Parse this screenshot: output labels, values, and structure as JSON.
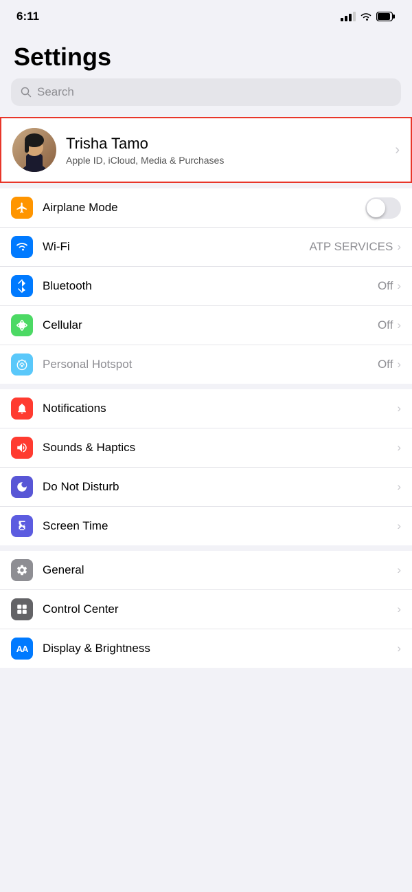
{
  "statusBar": {
    "time": "6:11"
  },
  "pageTitle": "Settings",
  "search": {
    "placeholder": "Search"
  },
  "profile": {
    "name": "Trisha Tamo",
    "subtitle": "Apple ID, iCloud, Media & Purchases"
  },
  "groups": [
    {
      "id": "connectivity",
      "rows": [
        {
          "id": "airplane",
          "label": "Airplane Mode",
          "iconColor": "ic-orange",
          "iconSymbol": "✈",
          "type": "toggle",
          "value": false
        },
        {
          "id": "wifi",
          "label": "Wi-Fi",
          "iconColor": "ic-blue",
          "iconSymbol": "wifi",
          "type": "value",
          "value": "ATP SERVICES"
        },
        {
          "id": "bluetooth",
          "label": "Bluetooth",
          "iconColor": "ic-blue-mid",
          "iconSymbol": "bt",
          "type": "value",
          "value": "Off"
        },
        {
          "id": "cellular",
          "label": "Cellular",
          "iconColor": "ic-green",
          "iconSymbol": "cell",
          "type": "value",
          "value": "Off"
        },
        {
          "id": "hotspot",
          "label": "Personal Hotspot",
          "iconColor": "ic-green-light",
          "iconSymbol": "hotspot",
          "type": "value",
          "value": "Off",
          "dimmed": true
        }
      ]
    },
    {
      "id": "notifications",
      "rows": [
        {
          "id": "notifications",
          "label": "Notifications",
          "iconColor": "ic-red",
          "iconSymbol": "notif",
          "type": "arrow"
        },
        {
          "id": "sounds",
          "label": "Sounds & Haptics",
          "iconColor": "ic-red-sound",
          "iconSymbol": "sound",
          "type": "arrow"
        },
        {
          "id": "donotdisturb",
          "label": "Do Not Disturb",
          "iconColor": "ic-purple",
          "iconSymbol": "moon",
          "type": "arrow"
        },
        {
          "id": "screentime",
          "label": "Screen Time",
          "iconColor": "ic-indigo",
          "iconSymbol": "hourglass",
          "type": "arrow"
        }
      ]
    },
    {
      "id": "system",
      "rows": [
        {
          "id": "general",
          "label": "General",
          "iconColor": "ic-gray",
          "iconSymbol": "gear",
          "type": "arrow"
        },
        {
          "id": "controlcenter",
          "label": "Control Center",
          "iconColor": "ic-gray2",
          "iconSymbol": "cc",
          "type": "arrow"
        },
        {
          "id": "display",
          "label": "Display & Brightness",
          "iconColor": "ic-blue-aa",
          "iconSymbol": "AA",
          "type": "arrow"
        }
      ]
    }
  ]
}
